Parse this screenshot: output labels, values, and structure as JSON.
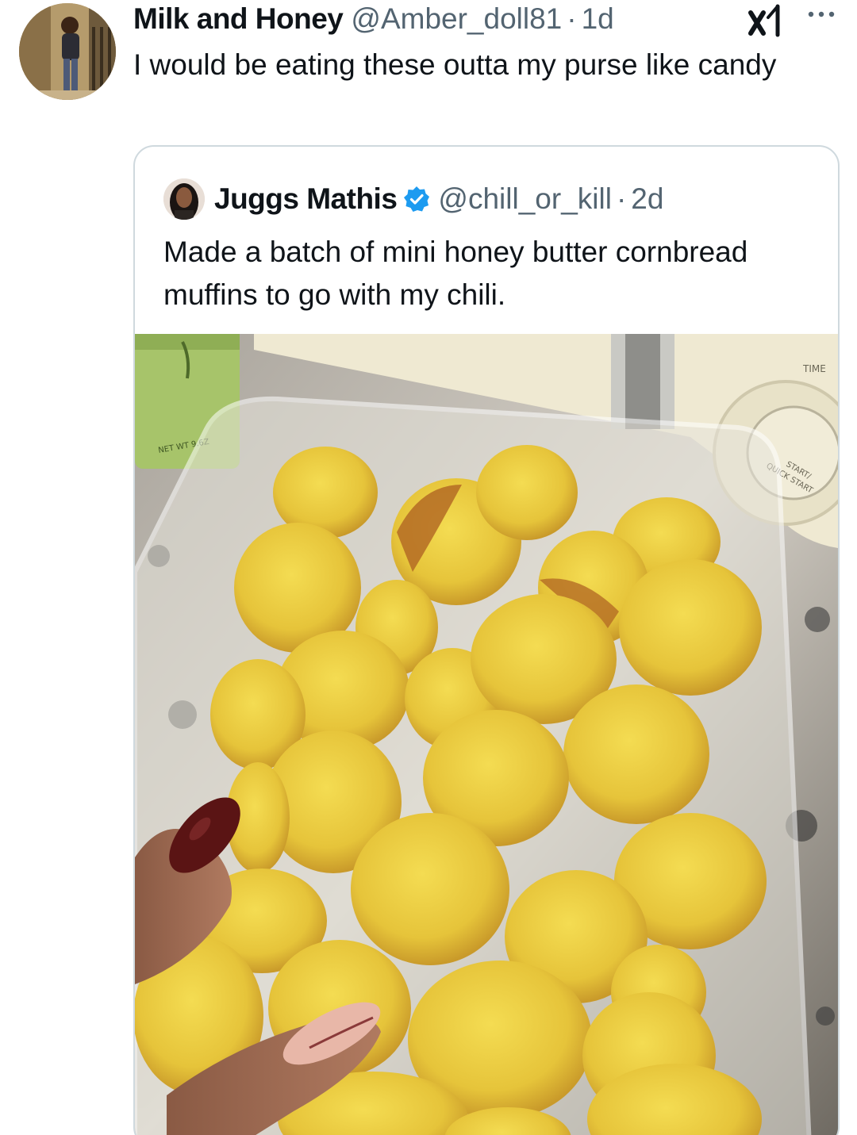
{
  "tweet": {
    "display_name": "Milk and Honey",
    "handle": "@Amber_doll81",
    "separator": "·",
    "time": "1d",
    "text": "I would be eating these outta my purse like candy",
    "avatar_icon": "profile-photo",
    "grok_icon": "grok-icon",
    "more_icon": "more-dots-icon"
  },
  "quote": {
    "display_name": "Juggs Mathis",
    "verified": true,
    "verified_color": "#1d9bf0",
    "handle": "@chill_or_kill",
    "separator": "·",
    "time": "2d",
    "text": "Made a batch of mini honey butter cornbread muffins to go with my chili.",
    "media": {
      "description_icon": "photo",
      "appliance_labels": {
        "time": "TIME",
        "start": "START/",
        "quick_start": "QUICK START"
      },
      "can_label": "NET WT 9.6Z"
    }
  },
  "colors": {
    "text_primary": "#0f1419",
    "text_secondary": "#536471",
    "border": "#cfd9de",
    "accent": "#1d9bf0"
  }
}
